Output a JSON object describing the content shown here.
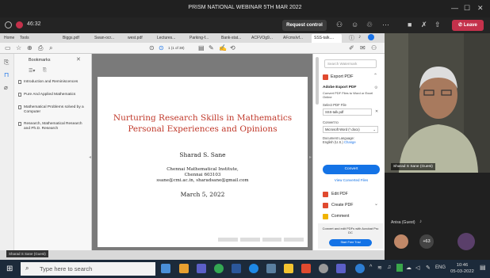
{
  "window": {
    "title": "PRISM NATIONAL WEBINAR 5TH MAR 2022"
  },
  "meeting": {
    "timer": "46:32",
    "request_control": "Request control",
    "leave": "Leave"
  },
  "browser": {
    "tabs": [
      "Home",
      "Tools",
      "Biggs.pdf",
      "Swan-ocr...",
      "west.pdf",
      "Lectures...",
      "Parking-f...",
      "Bank-stat...",
      "ACFVOg9...",
      "AFcmsIvf...",
      "SSS-talk...."
    ],
    "page_nav": "1 (1 of 38)"
  },
  "bookmarks": {
    "title": "Bookmarks",
    "items": [
      "Introduction and Reminiscences",
      "Pure And Applied Mathematics",
      "Mathematical Problems solved by a Computer",
      "Research, Mathematical Research and Ph.D. Research"
    ]
  },
  "slide": {
    "title_line1": "Nurturing Research Skills in Mathematics",
    "title_line2": "Personal Experiences and Opinions",
    "author": "Sharad S. Sane",
    "institute": "Chennai Mathematical Institute,",
    "city": "Chennai 603103",
    "emails": "ssane@cmi.ac.in, sharadsane@gmail.com",
    "date": "March 5, 2022"
  },
  "right_panel": {
    "search_placeholder": "Search Watermark",
    "export_pdf": "Export PDF",
    "adobe_export": "Adobe Export PDF",
    "convert_desc": "Convert PDF Files to Word or Excel Online",
    "select_pdf": "Select PDF File",
    "file": "SSS-talk.pdf",
    "convert_to": "Convert to",
    "format": "Microsoft Word (*.docx)",
    "doc_language": "Document Language:",
    "language": "English (U.S.)",
    "change": "Change",
    "convert_btn": "Convert",
    "view_converted": "View Converted Files",
    "edit_pdf": "Edit PDF",
    "create_pdf": "Create PDF",
    "comment": "Comment",
    "promo": "Convert and edit PDFs with Acrobat Pro DC",
    "trial": "Start Free Trial"
  },
  "participants": {
    "video_name": "Sharad S Sane (Guest)",
    "anisa": "Anisa (Guest)",
    "more": "+63",
    "presenter_label": "Sharad S Sane (Guest)"
  },
  "taskbar": {
    "search_placeholder": "Type here to search",
    "lang": "ENG",
    "time": "10:46",
    "date": "05-03-2022"
  }
}
